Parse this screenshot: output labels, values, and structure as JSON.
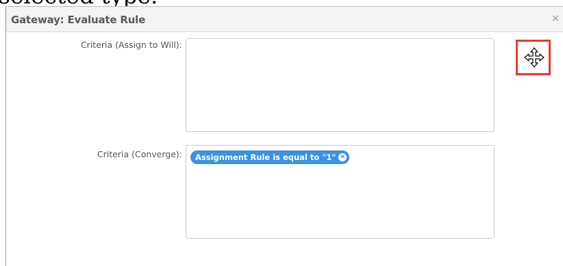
{
  "background": {
    "partial_text": "selected type."
  },
  "dialog": {
    "title": "Gateway: Evaluate Rule",
    "close_glyph": "×",
    "fields": {
      "assign": {
        "label": "Criteria (Assign to Will):"
      },
      "converge": {
        "label": "Criteria (Converge):",
        "token": {
          "text": "Assignment Rule is equal to \"1\"",
          "remove_glyph": "×"
        }
      }
    },
    "drag_handle": {
      "icon": "move-arrows-icon",
      "highlight_color": "#e8392f"
    }
  },
  "colors": {
    "token_bg": "#3a93e0",
    "header_bg": "#f3f3f3"
  }
}
